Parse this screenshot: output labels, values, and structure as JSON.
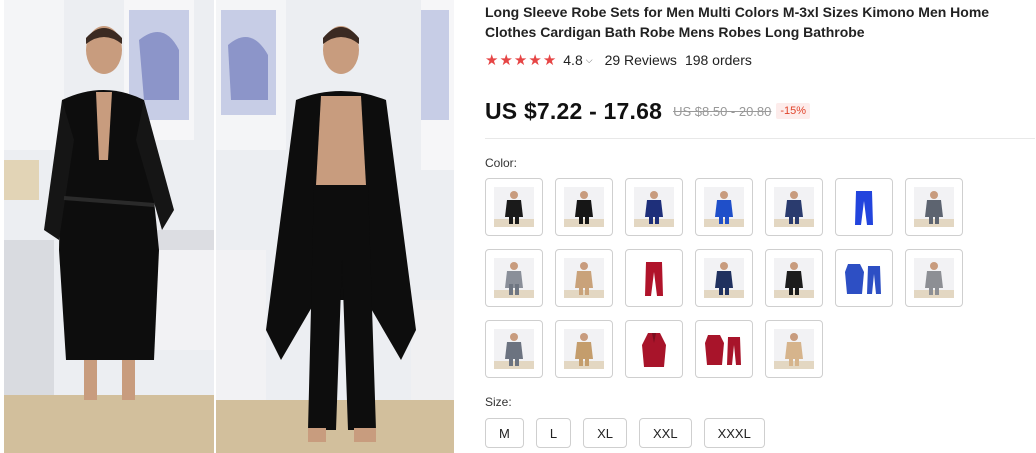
{
  "product": {
    "title": "Long Sleeve Robe Sets for Men Multi Colors M-3xl Sizes Kimono Men Home Clothes Cardigan Bath Robe Mens Robes Long Bathrobe",
    "rating": "4.8",
    "stars": 5,
    "reviews": "29 Reviews",
    "orders": "198 orders",
    "price": "US $7.22 - 17.68",
    "old_price": "US $8.50 - 20.80",
    "discount": "-15%"
  },
  "colors": {
    "accent": "#e64545",
    "label": "Color:",
    "swatches": [
      {
        "kind": "person",
        "robe": "#1a1a1a",
        "pants": "#1a1a1a"
      },
      {
        "kind": "person",
        "robe": "#161616",
        "pants": "#161616"
      },
      {
        "kind": "person",
        "robe": "#1e2f7a",
        "pants": "#1e2f7a"
      },
      {
        "kind": "person",
        "robe": "#1f4fc9",
        "pants": "#1f4fc9"
      },
      {
        "kind": "person",
        "robe": "#2a3b6e",
        "pants": "#2a3b6e"
      },
      {
        "kind": "pants",
        "robe": "#2244dd",
        "pants": "#2244dd"
      },
      {
        "kind": "person",
        "robe": "#5d6470",
        "pants": "#5d6470"
      },
      {
        "kind": "person",
        "robe": "#8a8f99",
        "pants": "#6f7682"
      },
      {
        "kind": "person",
        "robe": "#c9a27a",
        "pants": "#c9a27a"
      },
      {
        "kind": "pants",
        "robe": "#b0132a",
        "pants": "#b0132a"
      },
      {
        "kind": "person",
        "robe": "#20315f",
        "pants": "#20315f"
      },
      {
        "kind": "person",
        "robe": "#1c1c1c",
        "pants": "#1c1c1c"
      },
      {
        "kind": "set",
        "robe": "#2d4fc4",
        "pants": "#2d4fc4"
      },
      {
        "kind": "person",
        "robe": "#8d8f94",
        "pants": "#8d8f94"
      },
      {
        "kind": "person",
        "robe": "#6c7380",
        "pants": "#6c7380"
      },
      {
        "kind": "person",
        "robe": "#c49d6c",
        "pants": "#c49d6c"
      },
      {
        "kind": "robe",
        "robe": "#a8142a",
        "pants": "#a8142a"
      },
      {
        "kind": "set",
        "robe": "#a8142a",
        "pants": "#a8142a"
      },
      {
        "kind": "person",
        "robe": "#d6b48c",
        "pants": "#d6b48c"
      }
    ]
  },
  "sizes": {
    "label": "Size:",
    "options": [
      "M",
      "L",
      "XL",
      "XXL",
      "XXXL"
    ]
  },
  "gallery": {
    "robe_color": "#0d0d0d",
    "wall_color": "#e9ebf0",
    "art_color": "#8c95c9"
  }
}
